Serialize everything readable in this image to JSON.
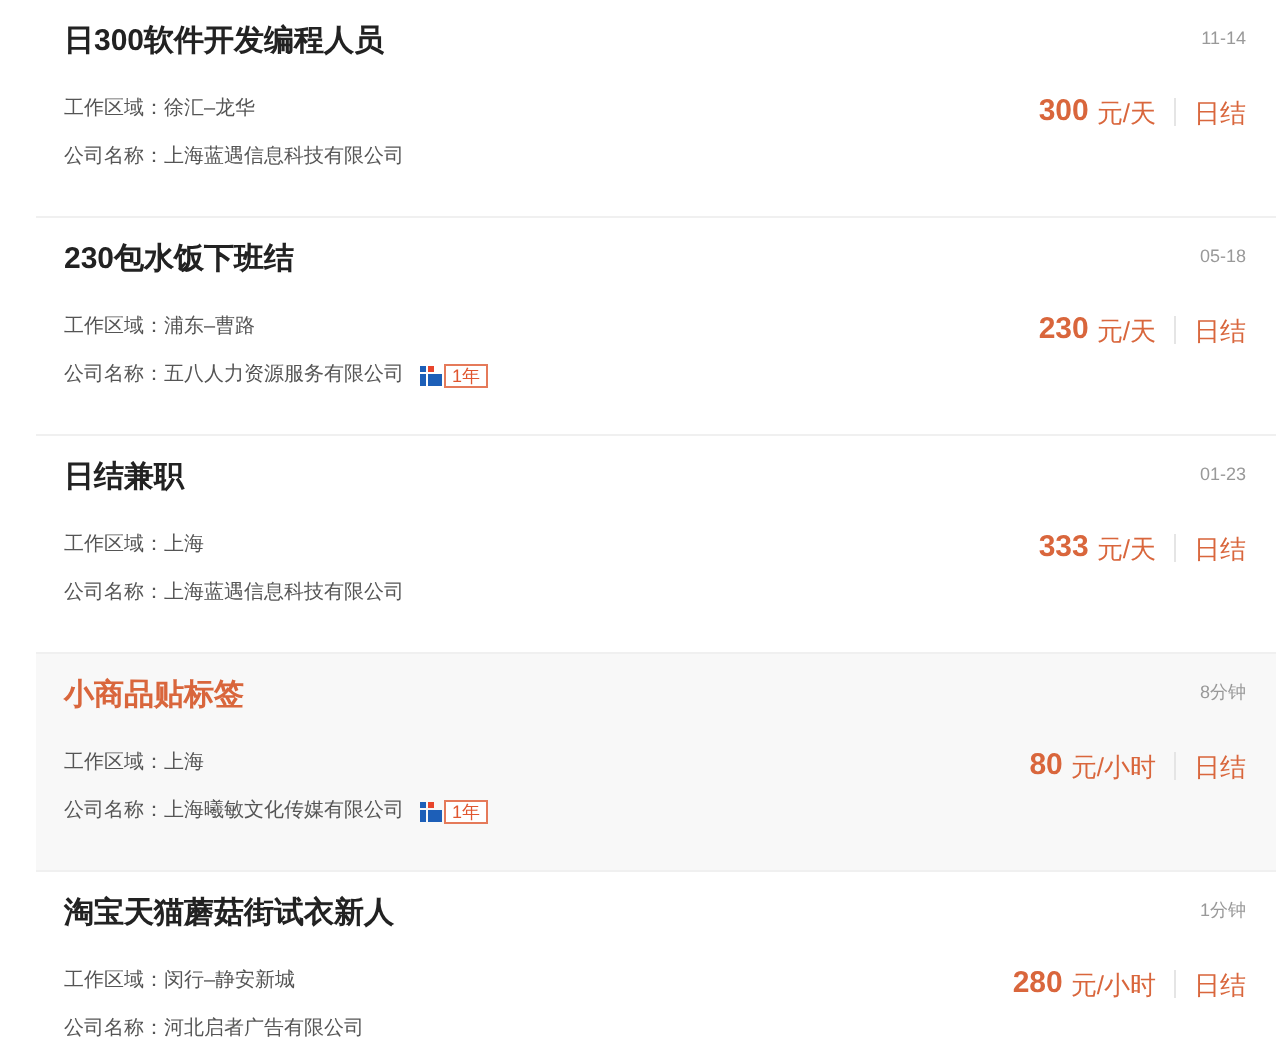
{
  "jobs": [
    {
      "title": "日300软件开发编程人员",
      "date": "11-14",
      "area_label": "工作区域：",
      "area": "徐汇–龙华",
      "company_label": "公司名称：",
      "company": "上海蓝遇信息科技有限公司",
      "amount": "300",
      "unit": "元/天",
      "settlement": "日结",
      "selected": false
    },
    {
      "title": "230包水饭下班结",
      "date": "05-18",
      "area_label": "工作区域：",
      "area": "浦东–曹路",
      "company_label": "公司名称：",
      "company": "五八人力资源服务有限公司",
      "badge": "1年",
      "amount": "230",
      "unit": "元/天",
      "settlement": "日结",
      "selected": false
    },
    {
      "title": "日结兼职",
      "date": "01-23",
      "area_label": "工作区域：",
      "area": "上海",
      "company_label": "公司名称：",
      "company": "上海蓝遇信息科技有限公司",
      "amount": "333",
      "unit": "元/天",
      "settlement": "日结",
      "selected": false
    },
    {
      "title": "小商品贴标签",
      "date": "8分钟",
      "area_label": "工作区域：",
      "area": "上海",
      "company_label": "公司名称：",
      "company": "上海曦敏文化传媒有限公司",
      "badge": "1年",
      "amount": "80",
      "unit": "元/小时",
      "settlement": "日结",
      "selected": true
    },
    {
      "title": "淘宝天猫蘑菇街试衣新人",
      "date": "1分钟",
      "area_label": "工作区域：",
      "area": "闵行–静安新城",
      "company_label": "公司名称：",
      "company": "河北启者广告有限公司",
      "amount": "280",
      "unit": "元/小时",
      "settlement": "日结",
      "selected": false
    }
  ]
}
